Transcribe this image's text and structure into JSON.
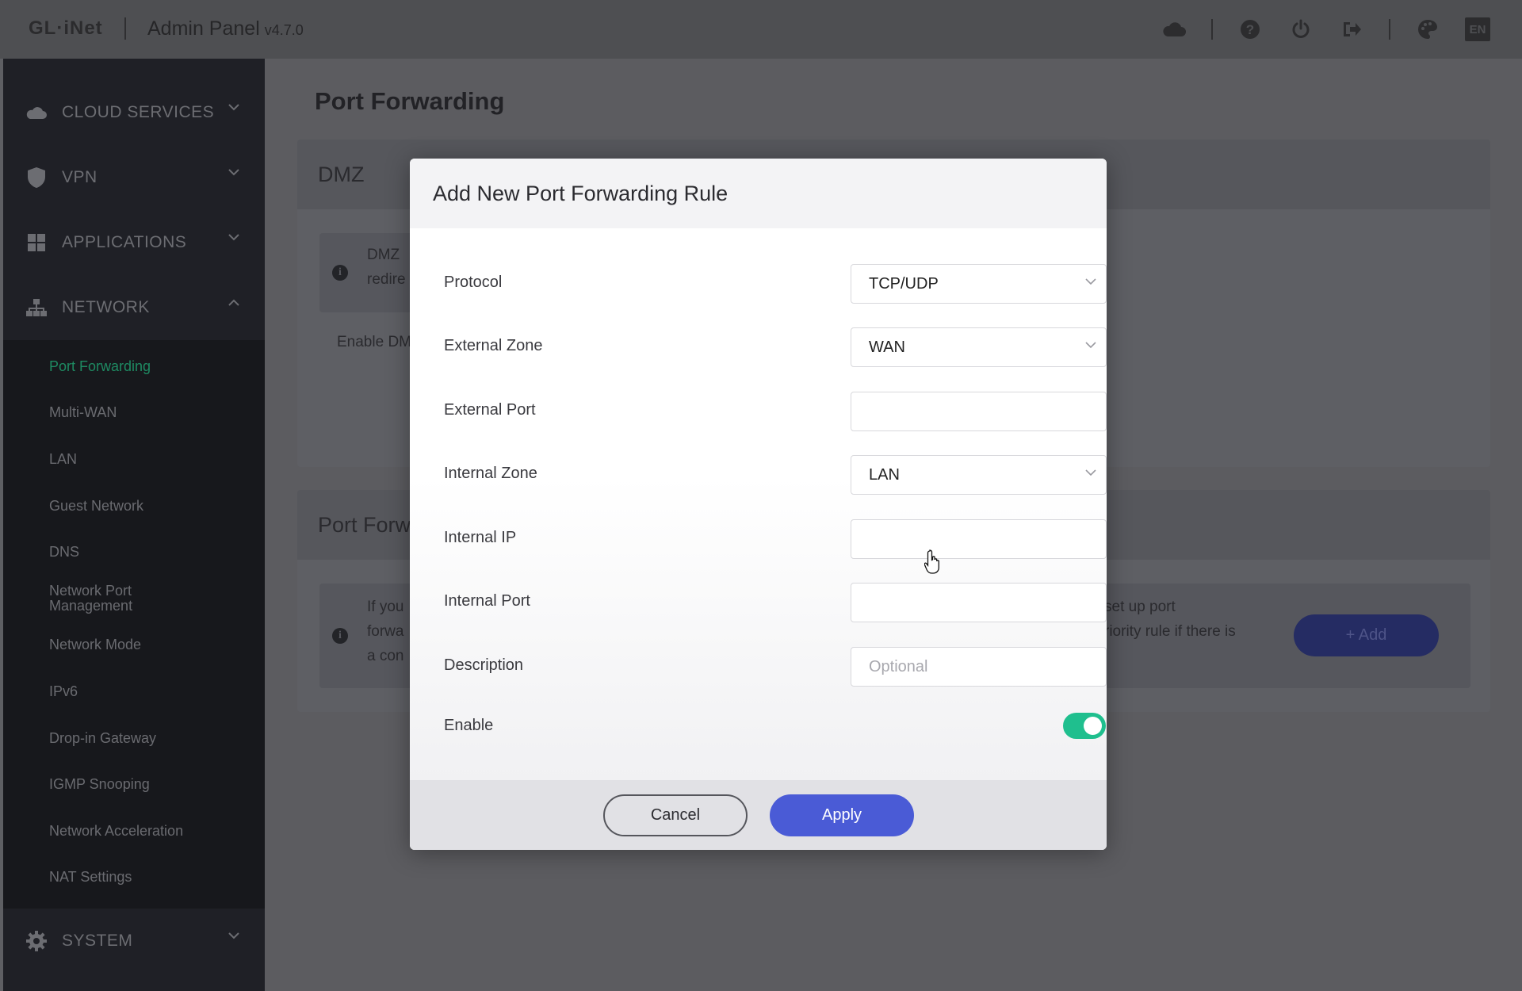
{
  "header": {
    "logo": "GL·iNet",
    "title": "Admin Panel",
    "version": "v4.7.0",
    "icons": [
      "cloud-icon",
      "help-icon",
      "power-icon",
      "logout-icon",
      "theme-icon"
    ],
    "language": "EN"
  },
  "sidebar": {
    "groups": [
      {
        "label": "CLOUD SERVICES",
        "icon": "cloud-icon",
        "expanded": false
      },
      {
        "label": "VPN",
        "icon": "shield-icon",
        "expanded": false
      },
      {
        "label": "APPLICATIONS",
        "icon": "grid-icon",
        "expanded": false
      },
      {
        "label": "NETWORK",
        "icon": "network-icon",
        "expanded": true
      },
      {
        "label": "SYSTEM",
        "icon": "gear-icon",
        "expanded": false
      }
    ],
    "network_items": [
      "Port Forwarding",
      "Multi-WAN",
      "LAN",
      "Guest Network",
      "DNS",
      "Network Port Management",
      "Network Mode",
      "IPv6",
      "Drop-in Gateway",
      "IGMP Snooping",
      "Network Acceleration",
      "NAT Settings"
    ],
    "active_item": "Port Forwarding"
  },
  "main": {
    "page_title": "Port Forwarding",
    "dmz_card": {
      "title": "DMZ",
      "info_line1": "DMZ",
      "info_line2": "redire",
      "enable_label": "Enable DM"
    },
    "pf_card": {
      "title": "Port Forw",
      "info_left_1": "If you",
      "info_left_2": "forwa",
      "info_left_3": "a con",
      "info_right_1": "set up port",
      "info_right_2": "riority rule if there is",
      "add_label": "+ Add"
    }
  },
  "modal": {
    "title": "Add New Port Forwarding Rule",
    "fields": {
      "protocol": {
        "label": "Protocol",
        "value": "TCP/UDP"
      },
      "external_zone": {
        "label": "External Zone",
        "value": "WAN"
      },
      "external_port": {
        "label": "External Port",
        "value": ""
      },
      "internal_zone": {
        "label": "Internal Zone",
        "value": "LAN"
      },
      "internal_ip": {
        "label": "Internal IP",
        "value": ""
      },
      "internal_port": {
        "label": "Internal Port",
        "value": ""
      },
      "description": {
        "label": "Description",
        "value": "",
        "placeholder": "Optional"
      },
      "enable": {
        "label": "Enable",
        "on": true
      }
    },
    "cancel_label": "Cancel",
    "apply_label": "Apply"
  },
  "colors": {
    "accent_green": "#1fbf8e",
    "primary_blue": "#4a5bd6",
    "active_nav": "#1e8a62"
  }
}
